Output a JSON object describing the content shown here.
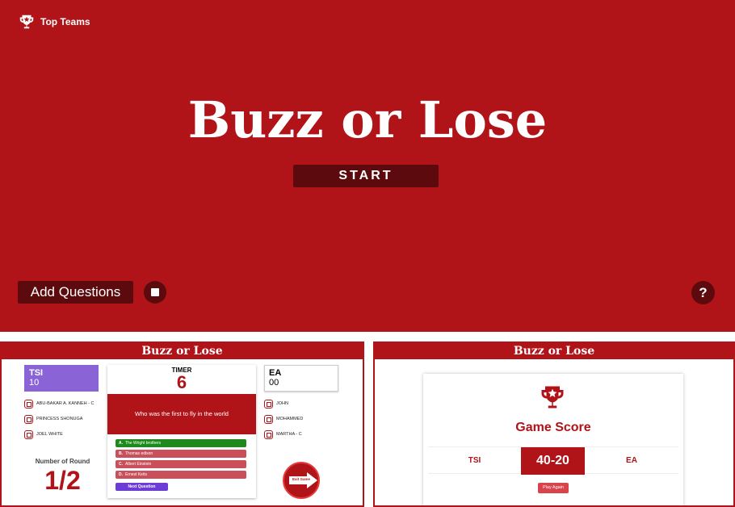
{
  "colors": {
    "brand_red": "#b01419",
    "dark_red": "#5c0a0d",
    "team_a": "#8a63d6",
    "correct": "#1e8a1e",
    "next": "#6c3cd6"
  },
  "hero": {
    "top_teams_label": "Top Teams",
    "top_teams_icon": "trophy-icon",
    "title": "Buzz or Lose",
    "start_label": "START",
    "add_questions_label": "Add Questions",
    "stop_icon": "stop-icon",
    "help_label": "?"
  },
  "game_panel": {
    "title": "Buzz or Lose",
    "team_a": {
      "name": "TSI",
      "score": "10",
      "players": [
        "ABU-BAKAR A. KANNEH - C",
        "PRINCESS SHONUGA",
        "JOEL WHITE"
      ]
    },
    "team_b": {
      "name": "EA",
      "score": "00",
      "players": [
        "JOHN",
        "MOHAMMED",
        "MARTHA - C"
      ]
    },
    "timer_label": "TIMER",
    "timer_value": "6",
    "question": "Who was the first to fly in the world",
    "options": [
      {
        "letter": "A.",
        "text": "The Wright brothers"
      },
      {
        "letter": "B.",
        "text": "Thomas edison"
      },
      {
        "letter": "C.",
        "text": "Albert Einstein"
      },
      {
        "letter": "D.",
        "text": "Ernest Keits"
      }
    ],
    "next_label": "Next Question",
    "round_label": "Number of Round",
    "round_value": "1/2",
    "exit_label": "Exit Game"
  },
  "score_panel": {
    "title": "Buzz or Lose",
    "heading": "Game Score",
    "team_a": "TSI",
    "score": "40-20",
    "team_b": "EA",
    "play_again_label": "Play Again"
  }
}
